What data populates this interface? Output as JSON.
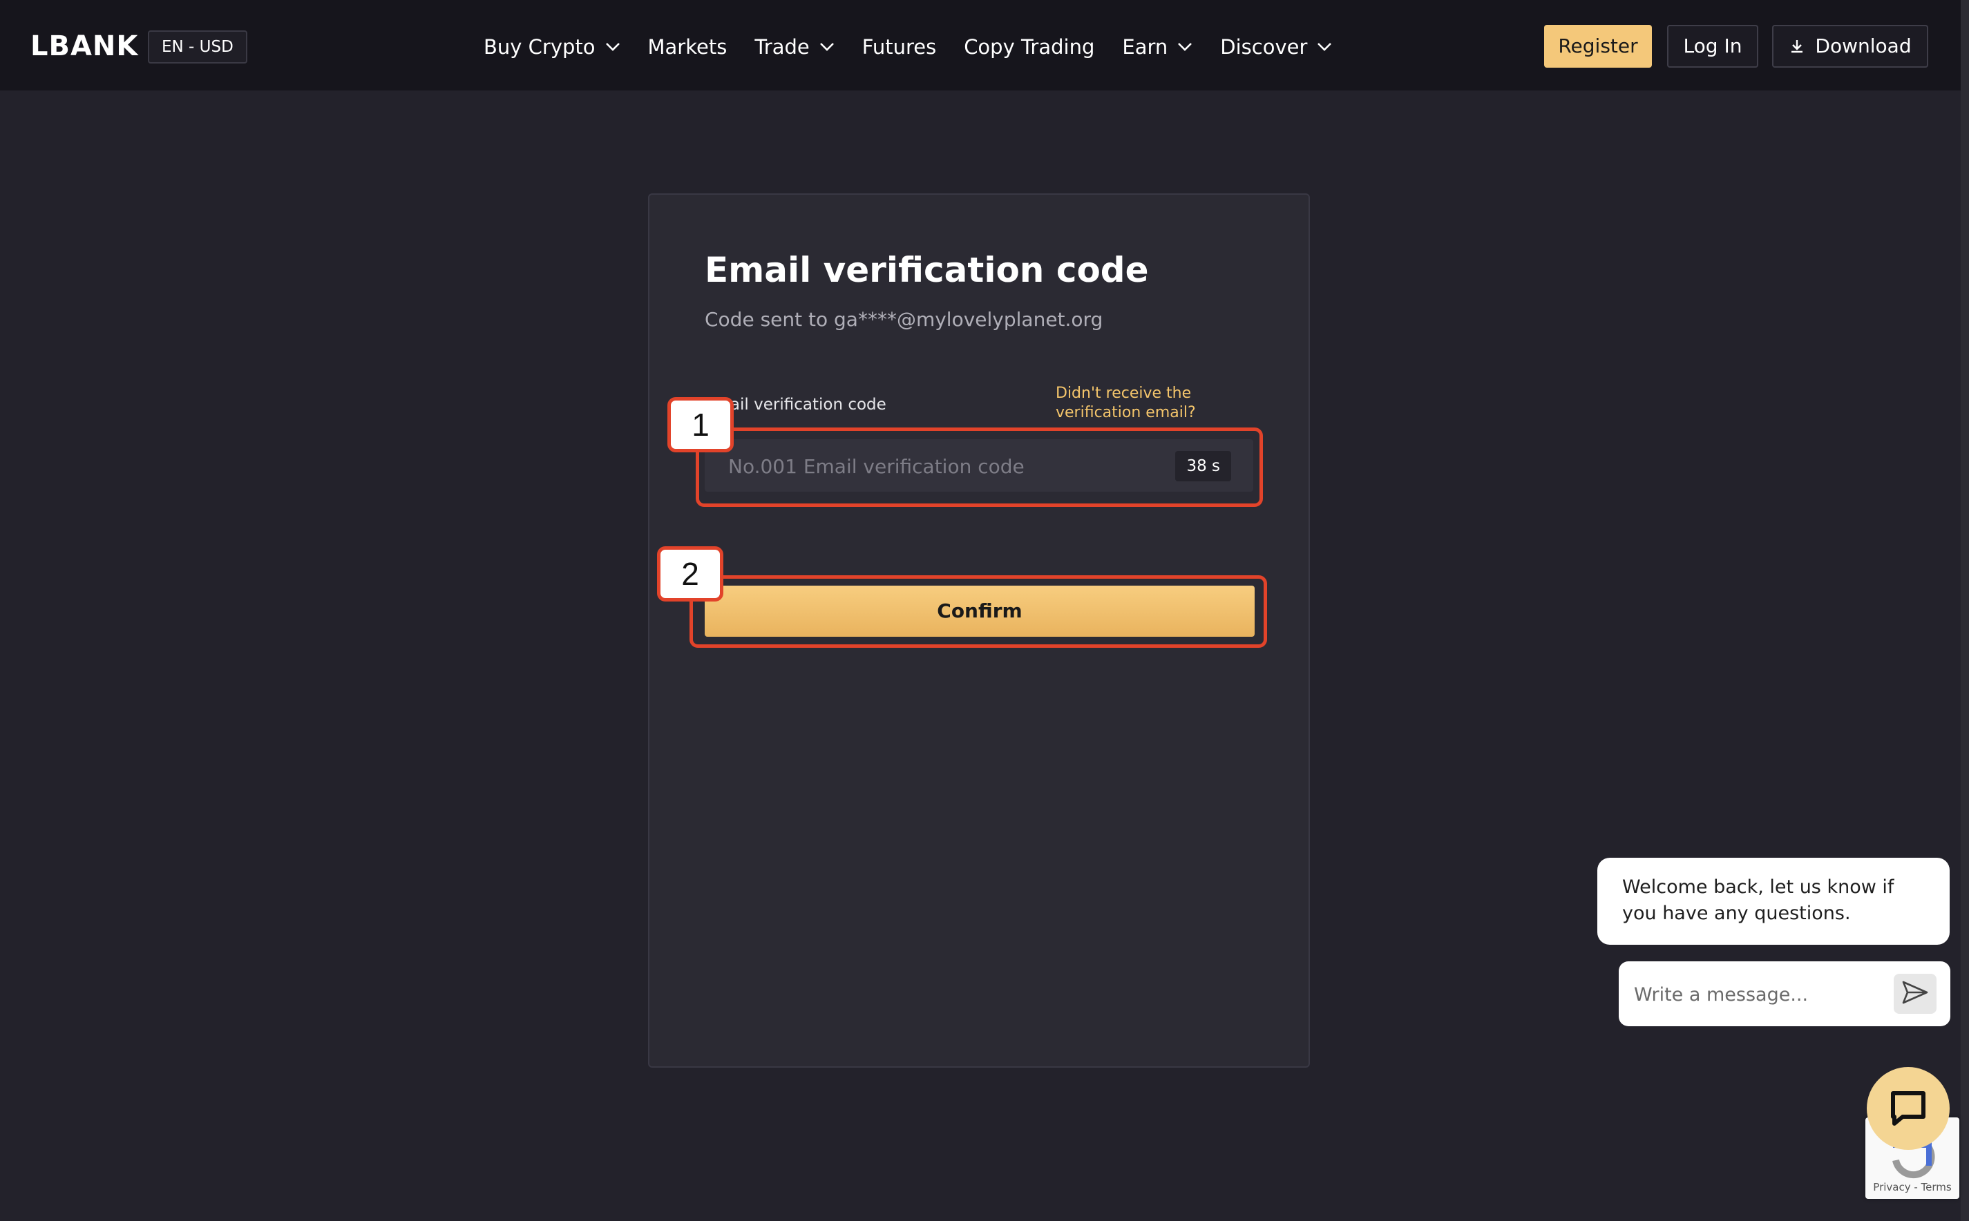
{
  "header": {
    "logo": "LBANK",
    "locale": "EN - USD",
    "nav": [
      {
        "label": "Buy Crypto",
        "dropdown": true
      },
      {
        "label": "Markets",
        "dropdown": false
      },
      {
        "label": "Trade",
        "dropdown": true
      },
      {
        "label": "Futures",
        "dropdown": false
      },
      {
        "label": "Copy Trading",
        "dropdown": false
      },
      {
        "label": "Earn",
        "dropdown": true
      },
      {
        "label": "Discover",
        "dropdown": true
      }
    ],
    "register_label": "Register",
    "login_label": "Log In",
    "download_label": "Download"
  },
  "verify": {
    "title": "Email verification code",
    "subtitle": "Code sent to ga****@mylovelyplanet.org",
    "field_label": "Email verification code",
    "resend_link": "Didn't receive the verification email?",
    "input_placeholder": "No.001 Email verification code",
    "input_value": "",
    "countdown": "38 s",
    "confirm_label": "Confirm"
  },
  "annotations": {
    "step1": "1",
    "step2": "2",
    "color": "#e2432a"
  },
  "chat": {
    "welcome": "Welcome back, let us know if you have any questions.",
    "input_placeholder": "Write a message...",
    "recaptcha_text": "Privacy - Terms"
  },
  "colors": {
    "background": "#23222b",
    "topbar": "#16151c",
    "accent": "#f4c87a",
    "link": "#f4c56b"
  },
  "icons": {
    "nav_dropdown": "chevron-down-icon",
    "download": "download-icon",
    "send": "send-icon",
    "chat_launcher": "chat-icon"
  }
}
